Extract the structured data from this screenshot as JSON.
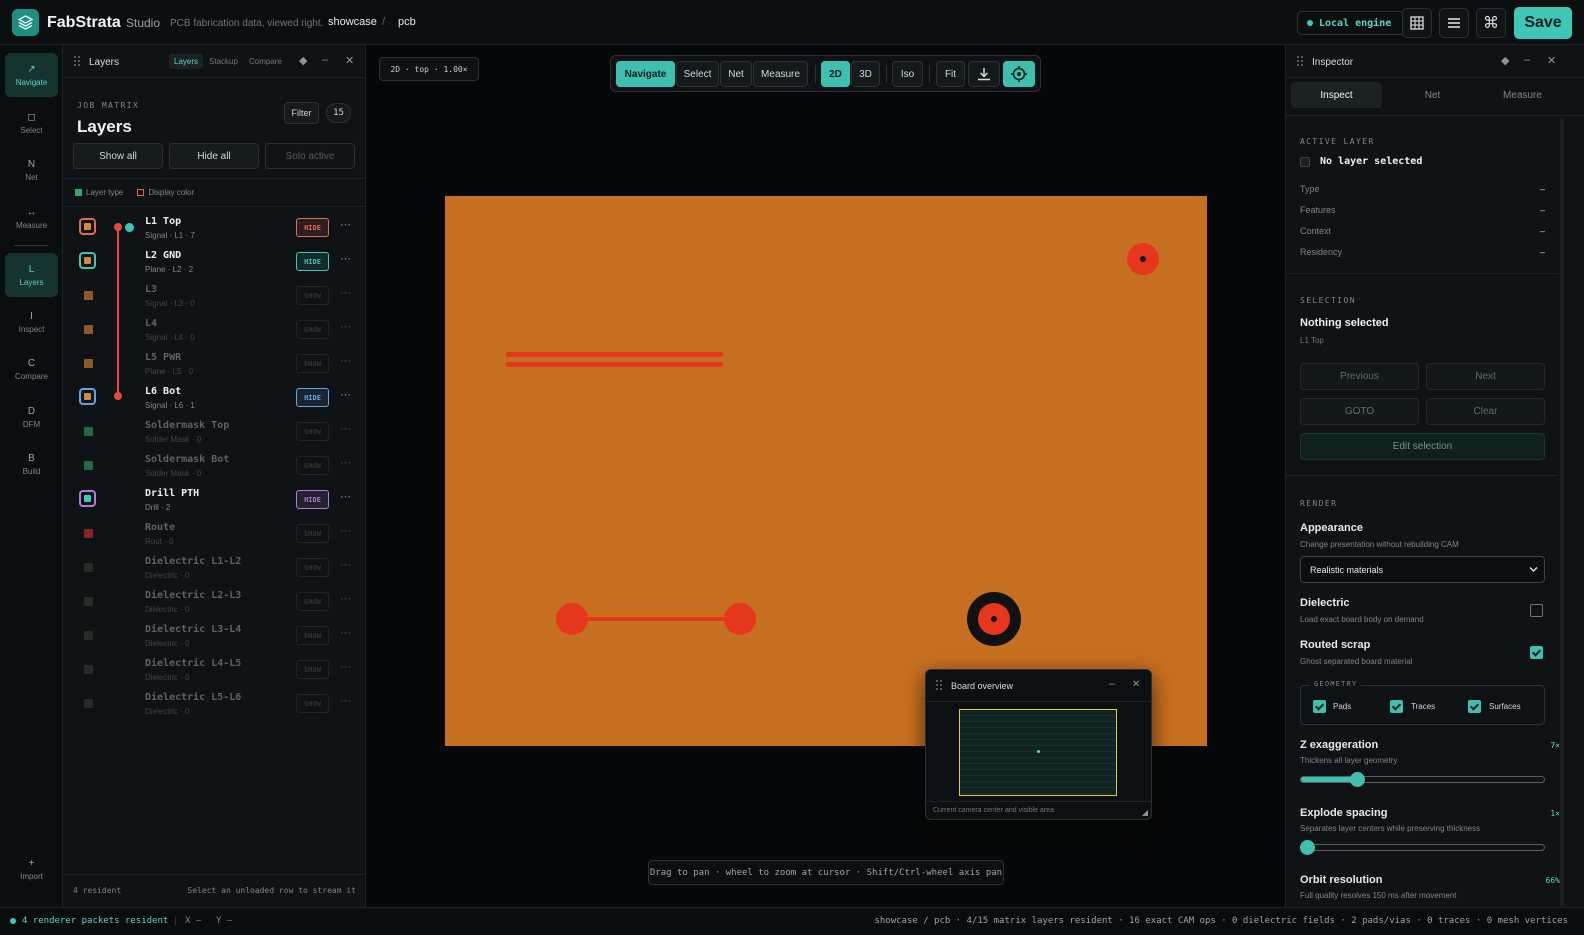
{
  "app": {
    "brand": "FabStrata",
    "studio": "Studio",
    "tagline": "PCB fabrication data, viewed right.",
    "crumbs": [
      "showcase",
      "pcb"
    ],
    "crumb_sep": "/",
    "engine": "Local engine",
    "save_label": "Save",
    "accent": "#40c6b6"
  },
  "rail": {
    "items": [
      {
        "glyph": "↗",
        "label": "Navigate",
        "active": true
      },
      {
        "glyph": "◻",
        "label": "Select"
      },
      {
        "glyph": "N",
        "label": "Net"
      },
      {
        "glyph": "↔",
        "label": "Measure"
      },
      {
        "glyph": "L",
        "label": "Layers",
        "active": true
      },
      {
        "glyph": "I",
        "label": "Inspect"
      },
      {
        "glyph": "C",
        "label": "Compare"
      },
      {
        "glyph": "D",
        "label": "DFM"
      },
      {
        "glyph": "B",
        "label": "Build"
      }
    ],
    "import": {
      "glyph": "+",
      "label": "Import"
    }
  },
  "layers_panel": {
    "title": "Layers",
    "tabs": [
      "Layers",
      "Stackup",
      "Compare"
    ],
    "eyebrow": "JOB MATRIX",
    "heading": "Layers",
    "filter_label": "Filter",
    "count": "15",
    "show_all": "Show all",
    "hide_all": "Hide all",
    "solo_active": "Solo active",
    "legend_type": "Layer type",
    "legend_color": "Display color",
    "rows": [
      {
        "name": "L1 Top",
        "sub": "Signal · L1 · 7",
        "btn": "HIDE",
        "active": true,
        "fill": "#d28a36",
        "ring": "#e46a52",
        "btn_color": "#e46a52"
      },
      {
        "name": "L2 GND",
        "sub": "Plane · L2 · 2",
        "btn": "HIDE",
        "active": true,
        "fill": "#d28a36",
        "ring": "#3fc6b8",
        "btn_color": "#3fc6b8"
      },
      {
        "name": "L3",
        "sub": "Signal · L3 · 0",
        "btn": "SHOW",
        "active": false,
        "fill": "#8a5a2a"
      },
      {
        "name": "L4",
        "sub": "Signal · L4 · 0",
        "btn": "SHOW",
        "active": false,
        "fill": "#8a5a2a"
      },
      {
        "name": "L5 PWR",
        "sub": "Plane · L5 · 0",
        "btn": "SHOW",
        "active": false,
        "fill": "#8a5a2a"
      },
      {
        "name": "L6 Bot",
        "sub": "Signal · L6 · 1",
        "btn": "HIDE",
        "active": true,
        "fill": "#d28a36",
        "ring": "#5aa8e8",
        "btn_color": "#5aa8e8"
      },
      {
        "name": "Soldermask Top",
        "sub": "Solder Mask · 0",
        "btn": "SHOW",
        "active": false,
        "fill": "#1f6b45"
      },
      {
        "name": "Soldermask Bot",
        "sub": "Solder Mask · 0",
        "btn": "SHOW",
        "active": false,
        "fill": "#1f6b45"
      },
      {
        "name": "Drill PTH",
        "sub": "Drill · 2",
        "btn": "HIDE",
        "active": true,
        "fill": "#3ec8b6",
        "ring": "#b07ad8",
        "btn_color": "#b07ad8"
      },
      {
        "name": "Route",
        "sub": "Rout · 0",
        "btn": "SHOW",
        "active": false,
        "fill": "#8a2424"
      },
      {
        "name": "Dielectric L1-L2",
        "sub": "Dielectric · 0",
        "btn": "SHOW",
        "active": false,
        "fill": "#2a2a26"
      },
      {
        "name": "Dielectric L2-L3",
        "sub": "Dielectric · 0",
        "btn": "SHOW",
        "active": false,
        "fill": "#2a2a26"
      },
      {
        "name": "Dielectric L3-L4",
        "sub": "Dielectric · 0",
        "btn": "SHOW",
        "active": false,
        "fill": "#2a2a26"
      },
      {
        "name": "Dielectric L4-L5",
        "sub": "Dielectric · 0",
        "btn": "SHOW",
        "active": false,
        "fill": "#2a2a26"
      },
      {
        "name": "Dielectric L5-L6",
        "sub": "Dielectric · 0",
        "btn": "SHOW",
        "active": false,
        "fill": "#2a2a26"
      }
    ],
    "footer_left": "4 resident",
    "footer_right": "Select an unloaded row to stream it"
  },
  "viewport": {
    "badge": "2D · top · 1.00×",
    "tools": [
      "Navigate",
      "Select",
      "Net",
      "Measure"
    ],
    "modes": [
      "2D",
      "3D"
    ],
    "iso": "Iso",
    "fit": "Fit",
    "board_color": "#c76f20",
    "copper_color": "#e5371d",
    "overview": {
      "title": "Board overview",
      "caption": "Current camera center and visible area"
    },
    "hint": "Drag to pan · wheel to zoom at cursor · Shift/Ctrl-wheel axis pan"
  },
  "inspector": {
    "title": "Inspector",
    "tabs": [
      "Inspect",
      "Net",
      "Measure"
    ],
    "active_layer_hd": "ACTIVE LAYER",
    "active_layer_value": "No layer selected",
    "props": [
      {
        "k": "Type",
        "v": "–"
      },
      {
        "k": "Features",
        "v": "–"
      },
      {
        "k": "Context",
        "v": "–"
      },
      {
        "k": "Residency",
        "v": "–"
      }
    ],
    "selection_hd": "SELECTION",
    "selection_title": "Nothing selected",
    "selection_layer": "L1 Top",
    "previous": "Previous",
    "next": "Next",
    "goto": "GOTO",
    "clear": "Clear",
    "edit_selection": "Edit selection",
    "render_hd": "RENDER",
    "appearance_label": "Appearance",
    "appearance_sub": "Change presentation without rebuilding CAM",
    "appearance_value": "Realistic materials",
    "dielectric_label": "Dielectric",
    "dielectric_sub": "Load exact board body on demand",
    "dielectric_checked": false,
    "routed_label": "Routed scrap",
    "routed_sub": "Ghost separated board material",
    "routed_checked": true,
    "geometry_hd": "GEOMETRY",
    "geometry": [
      {
        "label": "Pads",
        "checked": true
      },
      {
        "label": "Traces",
        "checked": true
      },
      {
        "label": "Surfaces",
        "checked": true
      }
    ],
    "z_label": "Z exaggeration",
    "z_sub": "Thickens all layer geometry",
    "z_value": "7×",
    "z_fraction": 0.23,
    "explode_label": "Explode spacing",
    "explode_sub": "Separates layer centers while preserving thickness",
    "explode_value": "1×",
    "explode_fraction": 0.0,
    "orbit_label": "Orbit resolution",
    "orbit_sub": "Full quality resolves 150 ms after movement",
    "orbit_value": "66%"
  },
  "status": {
    "resident": "4 renderer packets resident",
    "x": "X –",
    "y": "Y –",
    "summary": "showcase / pcb · 4/15 matrix layers resident · 16 exact CAM ops · 0 dielectric fields · 2 pads/vias · 0 traces · 0 mesh vertices"
  }
}
